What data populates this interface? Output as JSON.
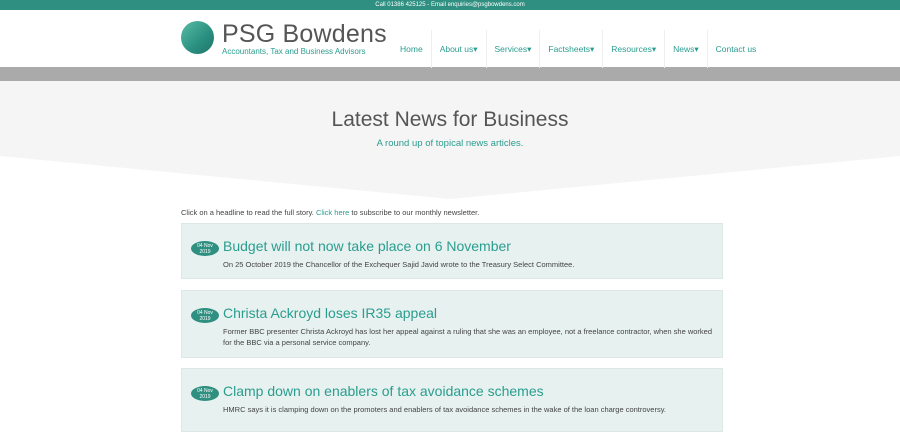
{
  "topbar": {
    "text": "Call 01386 425125 - Email enquiries@psgbowdens.com"
  },
  "brand": {
    "name": "PSG Bowdens",
    "tagline": "Accountants, Tax and Business Advisors"
  },
  "nav": {
    "items": [
      {
        "label": "Home"
      },
      {
        "label": "About us▾"
      },
      {
        "label": "Services▾"
      },
      {
        "label": "Factsheets▾"
      },
      {
        "label": "Resources▾"
      },
      {
        "label": "News▾"
      },
      {
        "label": "Contact us"
      }
    ]
  },
  "hero": {
    "title": "Latest News for Business",
    "subtitle": "A round up of topical news articles."
  },
  "intro": {
    "before": "Click on a headline to read the full story. ",
    "link": "Click here",
    "after": " to subscribe to our monthly newsletter."
  },
  "articles": [
    {
      "date_day": "04 Nov",
      "date_year": "2019",
      "title": "Budget will not now take place on 6 November",
      "summary": "On 25 October 2019 the Chancellor of the Exchequer Sajid Javid wrote to the Treasury Select Committee."
    },
    {
      "date_day": "04 Nov",
      "date_year": "2019",
      "title": "Christa Ackroyd loses IR35 appeal",
      "summary": "Former BBC presenter Christa Ackroyd has lost her appeal against a ruling that she was an employee, not a freelance contractor, when she worked for the BBC via a personal service company."
    },
    {
      "date_day": "04 Nov",
      "date_year": "2019",
      "title": "Clamp down on enablers of tax avoidance schemes",
      "summary": "HMRC says it is clamping down on the promoters and enablers of tax avoidance schemes in the wake of the loan charge controversy."
    }
  ],
  "colors": {
    "accent": "#2a9d8f",
    "topbar": "#2f8f80",
    "card_bg": "#e7f1ef",
    "hero_bg": "#f5f5f5"
  }
}
